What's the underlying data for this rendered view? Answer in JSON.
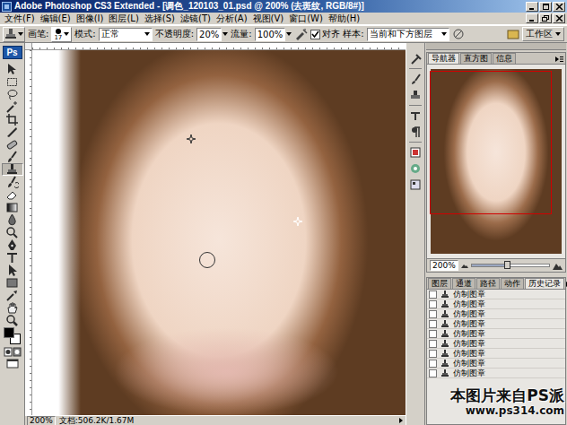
{
  "window": {
    "title": "Adobe Photoshop CS3 Extended - [调色_120103_01.psd @ 200% (去斑纹, RGB/8#)]"
  },
  "menu": [
    "文件(F)",
    "编辑(E)",
    "图像(I)",
    "图层(L)",
    "选择(S)",
    "滤镜(T)",
    "分析(A)",
    "视图(V)",
    "窗口(W)",
    "帮助(H)"
  ],
  "options": {
    "brush_label": "画笔:",
    "brush_size": "17",
    "mode_label": "模式:",
    "mode": "正常",
    "opacity_label": "不透明度:",
    "opacity": "20%",
    "flow_label": "流量:",
    "flow": "100%",
    "aligned": {
      "label": "对齐",
      "checked": true
    },
    "sample_label": "样本:",
    "sample": "当前和下方图层",
    "workspace": "工作区"
  },
  "toolbox": {
    "logo": "Ps",
    "tools": [
      {
        "selected": false
      },
      {
        "selected": false
      },
      {
        "selected": false
      },
      {
        "selected": false
      },
      {
        "selected": false
      },
      {
        "selected": false
      },
      {
        "selected": false
      },
      {
        "selected": false
      },
      {
        "selected": true
      },
      {
        "selected": false
      },
      {
        "selected": false
      },
      {
        "selected": false
      },
      {
        "selected": false
      },
      {
        "selected": false
      },
      {
        "selected": false
      },
      {
        "selected": false
      },
      {
        "selected": false
      },
      {
        "selected": false
      },
      {
        "selected": false
      },
      {
        "selected": false
      },
      {
        "selected": false
      }
    ]
  },
  "status_bar": {
    "zoom": "200%",
    "document": "文档:506.2K/1.67M"
  },
  "navigator": {
    "tabs": [
      {
        "label": "导航器",
        "selected": true
      },
      {
        "label": "直方图",
        "selected": false
      },
      {
        "label": "信息",
        "selected": false
      }
    ],
    "zoom": "200%",
    "level": 0.45
  },
  "history": {
    "tabs": [
      {
        "label": "图层",
        "selected": false
      },
      {
        "label": "通道",
        "selected": false
      },
      {
        "label": "路径",
        "selected": false
      },
      {
        "label": "动作",
        "selected": false
      },
      {
        "label": "历史记录",
        "selected": true
      }
    ],
    "rows": [
      {
        "label": "仿制图章",
        "selected": false
      },
      {
        "label": "仿制图章",
        "selected": false
      },
      {
        "label": "仿制图章",
        "selected": false
      },
      {
        "label": "仿制图章",
        "selected": false
      },
      {
        "label": "仿制图章",
        "selected": false
      },
      {
        "label": "仿制图章",
        "selected": false
      },
      {
        "label": "仿制图章",
        "selected": false
      },
      {
        "label": "仿制图章",
        "selected": false
      },
      {
        "label": "仿制图章",
        "selected": false
      }
    ]
  },
  "watermark": {
    "line1": "本图片来自PS派",
    "line2": "www.ps314.com"
  }
}
